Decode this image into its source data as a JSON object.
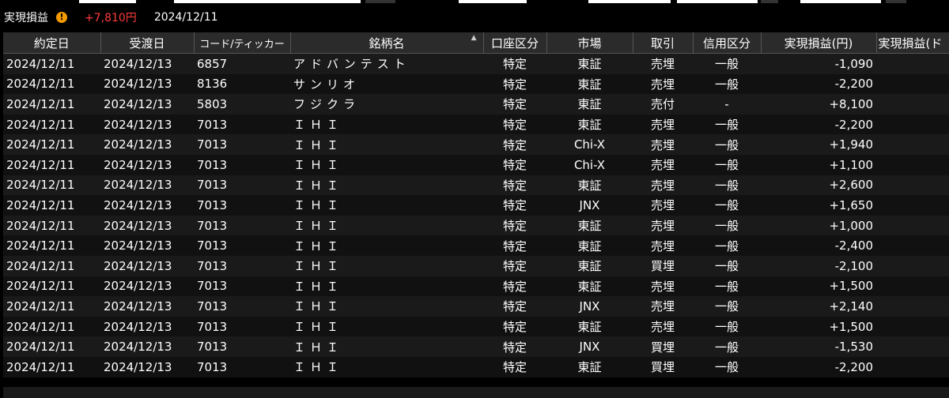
{
  "summary": {
    "label": "実現損益",
    "pl": "+7,810円",
    "date": "2024/12/11"
  },
  "columns": [
    "約定日",
    "受渡日",
    "コード/ティッカー",
    "銘柄名",
    "口座区分",
    "市場",
    "取引",
    "信用区分",
    "実現損益(円)",
    "実現損益(ド"
  ],
  "rows": [
    {
      "trade_date": "2024/12/11",
      "settle_date": "2024/12/13",
      "code": "6857",
      "name": "アドバンテスト",
      "account": "特定",
      "market": "東証",
      "trade": "売埋",
      "margin": "一般",
      "pl": "-1,090"
    },
    {
      "trade_date": "2024/12/11",
      "settle_date": "2024/12/13",
      "code": "8136",
      "name": "サンリオ",
      "account": "特定",
      "market": "東証",
      "trade": "売埋",
      "margin": "一般",
      "pl": "-2,200"
    },
    {
      "trade_date": "2024/12/11",
      "settle_date": "2024/12/13",
      "code": "5803",
      "name": "フジクラ",
      "account": "特定",
      "market": "東証",
      "trade": "売付",
      "margin": "-",
      "pl": "+8,100"
    },
    {
      "trade_date": "2024/12/11",
      "settle_date": "2024/12/13",
      "code": "7013",
      "name": "ＩＨＩ",
      "account": "特定",
      "market": "東証",
      "trade": "売埋",
      "margin": "一般",
      "pl": "-2,200"
    },
    {
      "trade_date": "2024/12/11",
      "settle_date": "2024/12/13",
      "code": "7013",
      "name": "ＩＨＩ",
      "account": "特定",
      "market": "Chi-X",
      "trade": "売埋",
      "margin": "一般",
      "pl": "+1,940"
    },
    {
      "trade_date": "2024/12/11",
      "settle_date": "2024/12/13",
      "code": "7013",
      "name": "ＩＨＩ",
      "account": "特定",
      "market": "Chi-X",
      "trade": "売埋",
      "margin": "一般",
      "pl": "+1,100"
    },
    {
      "trade_date": "2024/12/11",
      "settle_date": "2024/12/13",
      "code": "7013",
      "name": "ＩＨＩ",
      "account": "特定",
      "market": "東証",
      "trade": "売埋",
      "margin": "一般",
      "pl": "+2,600"
    },
    {
      "trade_date": "2024/12/11",
      "settle_date": "2024/12/13",
      "code": "7013",
      "name": "ＩＨＩ",
      "account": "特定",
      "market": "JNX",
      "trade": "売埋",
      "margin": "一般",
      "pl": "+1,650"
    },
    {
      "trade_date": "2024/12/11",
      "settle_date": "2024/12/13",
      "code": "7013",
      "name": "ＩＨＩ",
      "account": "特定",
      "market": "東証",
      "trade": "売埋",
      "margin": "一般",
      "pl": "+1,000"
    },
    {
      "trade_date": "2024/12/11",
      "settle_date": "2024/12/13",
      "code": "7013",
      "name": "ＩＨＩ",
      "account": "特定",
      "market": "東証",
      "trade": "売埋",
      "margin": "一般",
      "pl": "-2,400"
    },
    {
      "trade_date": "2024/12/11",
      "settle_date": "2024/12/13",
      "code": "7013",
      "name": "ＩＨＩ",
      "account": "特定",
      "market": "東証",
      "trade": "買埋",
      "margin": "一般",
      "pl": "-2,100"
    },
    {
      "trade_date": "2024/12/11",
      "settle_date": "2024/12/13",
      "code": "7013",
      "name": "ＩＨＩ",
      "account": "特定",
      "market": "東証",
      "trade": "売埋",
      "margin": "一般",
      "pl": "+1,500"
    },
    {
      "trade_date": "2024/12/11",
      "settle_date": "2024/12/13",
      "code": "7013",
      "name": "ＩＨＩ",
      "account": "特定",
      "market": "JNX",
      "trade": "売埋",
      "margin": "一般",
      "pl": "+2,140"
    },
    {
      "trade_date": "2024/12/11",
      "settle_date": "2024/12/13",
      "code": "7013",
      "name": "ＩＨＩ",
      "account": "特定",
      "market": "東証",
      "trade": "売埋",
      "margin": "一般",
      "pl": "+1,500"
    },
    {
      "trade_date": "2024/12/11",
      "settle_date": "2024/12/13",
      "code": "7013",
      "name": "ＩＨＩ",
      "account": "特定",
      "market": "JNX",
      "trade": "買埋",
      "margin": "一般",
      "pl": "-1,530"
    },
    {
      "trade_date": "2024/12/11",
      "settle_date": "2024/12/13",
      "code": "7013",
      "name": "ＩＨＩ",
      "account": "特定",
      "market": "東証",
      "trade": "買埋",
      "margin": "一般",
      "pl": "-2,200"
    }
  ],
  "colors": {
    "sell": "#4bd04b",
    "buy": "#ff7a2a",
    "profit": "#ff3b3b",
    "loss": "#4bd04b",
    "warning": "#f39a00"
  },
  "icons": {
    "warning": "warning-icon",
    "sort": "sort-ascending-icon"
  }
}
